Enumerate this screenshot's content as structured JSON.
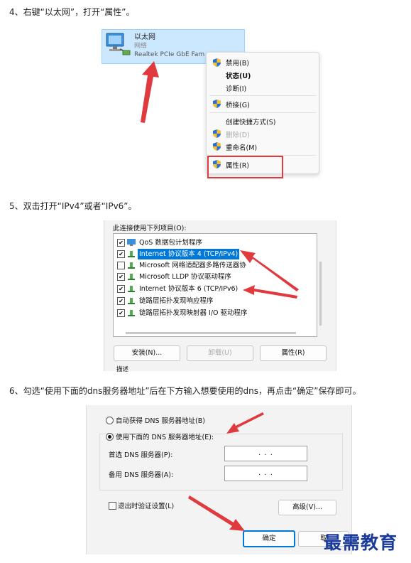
{
  "step4": {
    "instruction": "4、右键“以太网”，打开“属性”。",
    "adapter": {
      "name": "以太网",
      "type": "网络",
      "device": "Realtek PCIe GbE Fam"
    },
    "menu": [
      {
        "label": "禁用(B)",
        "shield": true,
        "bold": false,
        "disabled": false
      },
      {
        "label": "状态(U)",
        "shield": false,
        "bold": true,
        "disabled": false
      },
      {
        "label": "诊断(I)",
        "shield": false,
        "bold": false,
        "disabled": false
      },
      {
        "label": "桥接(G)",
        "shield": true,
        "bold": false,
        "disabled": false
      },
      {
        "label": "创建快捷方式(S)",
        "shield": false,
        "bold": false,
        "disabled": false
      },
      {
        "label": "删除(D)",
        "shield": true,
        "bold": false,
        "disabled": true
      },
      {
        "label": "重命名(M)",
        "shield": true,
        "bold": false,
        "disabled": false
      },
      {
        "label": "属性(R)",
        "shield": true,
        "bold": false,
        "disabled": false
      }
    ]
  },
  "step5": {
    "instruction": "5、双击打开“IPv4”或者“IPv6”。",
    "list_label": "此连接使用下列项目(O):",
    "items": [
      {
        "label": "QoS 数据包计划程序",
        "checked": true,
        "selected": false,
        "icon": "monitor-icon"
      },
      {
        "label": "Internet 协议版本 4 (TCP/IPv4)",
        "checked": true,
        "selected": true,
        "icon": "protocol-icon"
      },
      {
        "label": "Microsoft 网络适配器多路传送器协",
        "checked": false,
        "selected": false,
        "icon": "protocol-icon"
      },
      {
        "label": "Microsoft LLDP 协议驱动程序",
        "checked": true,
        "selected": false,
        "icon": "protocol-icon"
      },
      {
        "label": "Internet 协议版本 6 (TCP/IPv6)",
        "checked": true,
        "selected": false,
        "icon": "protocol-icon"
      },
      {
        "label": "链路层拓扑发现响应程序",
        "checked": true,
        "selected": false,
        "icon": "protocol-icon"
      },
      {
        "label": "链路层拓扑发现映射器 I/O 驱动程序",
        "checked": true,
        "selected": false,
        "icon": "protocol-icon"
      }
    ],
    "buttons": {
      "install": "安装(N)...",
      "uninstall": "卸载(U)",
      "properties": "属性(R)"
    },
    "description_label": "描述"
  },
  "step6": {
    "instruction": "6、勾选“使用下面的dns服务器地址”后在下方输入想要使用的dns，再点击“确定”保存即可。",
    "auto_dns": "自动获得 DNS 服务器地址(B)",
    "manual_dns": "使用下面的 DNS 服务器地址(E):",
    "preferred_label": "首选 DNS 服务器(P):",
    "alternate_label": "备用 DNS 服务器(A):",
    "preferred_value": ". . .",
    "alternate_value": ". . .",
    "validate_label": "退出时验证设置(L)",
    "advanced_button": "高级(V)...",
    "ok_button": "确定",
    "cancel_button": "取"
  },
  "watermark": "最需教育",
  "colors": {
    "arrow": "#e0393e",
    "selection": "#0078d7",
    "adapter_highlight": "#cce8ff",
    "watermark": "#1a3b9c"
  }
}
